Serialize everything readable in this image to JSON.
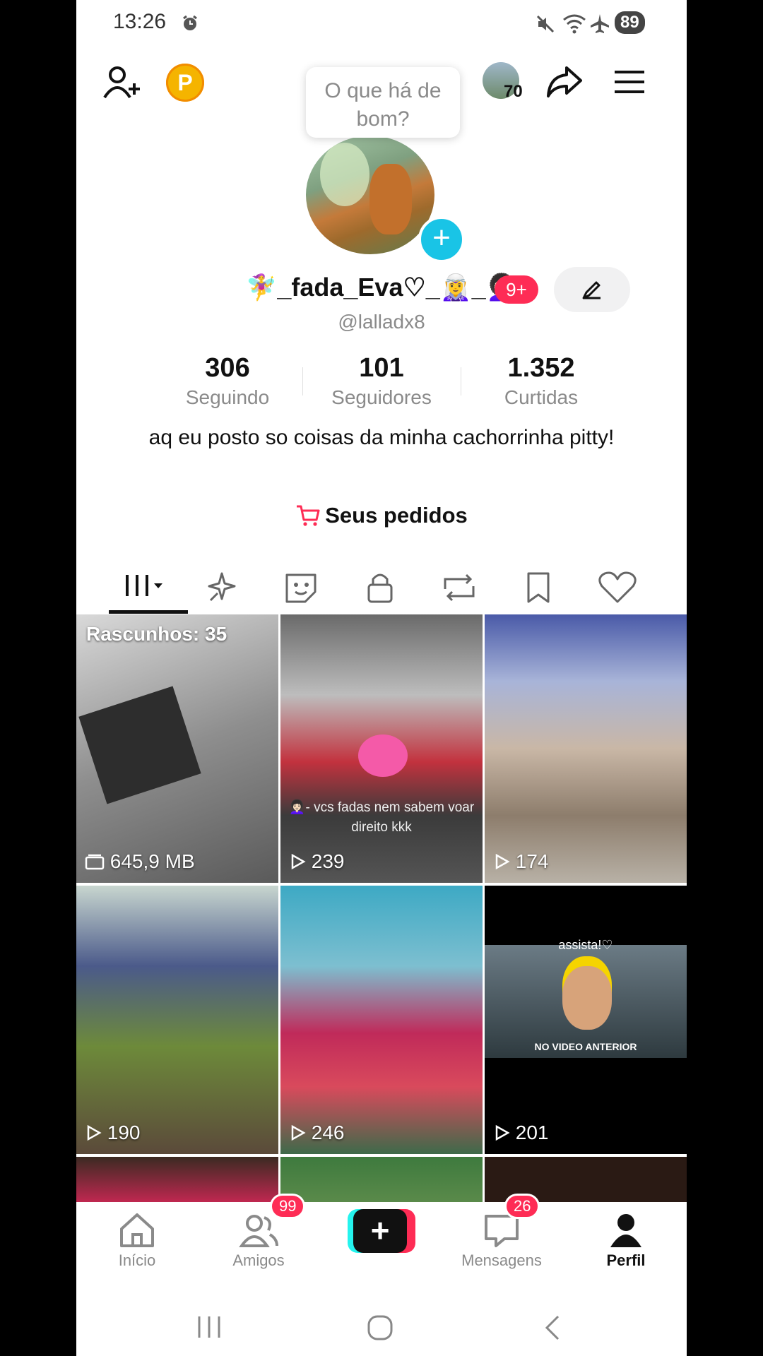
{
  "status_bar": {
    "time": "13:26",
    "battery": "89"
  },
  "header": {
    "coin_letter": "P",
    "story_count": "70",
    "tooltip": "O que há de bom?"
  },
  "profile": {
    "display_name": "🧚‍♀️_fada_Eva♡_🧝‍♀️_👩🏻‍🦱",
    "notif_badge": "9+",
    "handle": "@lalladx8",
    "stats": [
      {
        "value": "306",
        "label": "Seguindo"
      },
      {
        "value": "101",
        "label": "Seguidores"
      },
      {
        "value": "1.352",
        "label": "Curtidas"
      }
    ],
    "bio": "aq eu posto so coisas da minha cachorrinha pitty!",
    "orders_label": "Seus pedidos"
  },
  "grid": {
    "drafts_label": "Rascunhos: 35",
    "drafts_size": "645,9 MB",
    "items": [
      {
        "views": "239",
        "caption": "👩🏻‍🦱- vcs fadas nem sabem voar direito kkk"
      },
      {
        "views": "174"
      },
      {
        "views": "190"
      },
      {
        "views": "246"
      },
      {
        "views": "201",
        "caption_top": "assista!♡",
        "caption_bottom": "NO VIDEO ANTERIOR"
      }
    ]
  },
  "bottom_nav": {
    "home": "Início",
    "friends": "Amigos",
    "friends_badge": "99",
    "messages": "Mensagens",
    "messages_badge": "26",
    "profile": "Perfil"
  }
}
